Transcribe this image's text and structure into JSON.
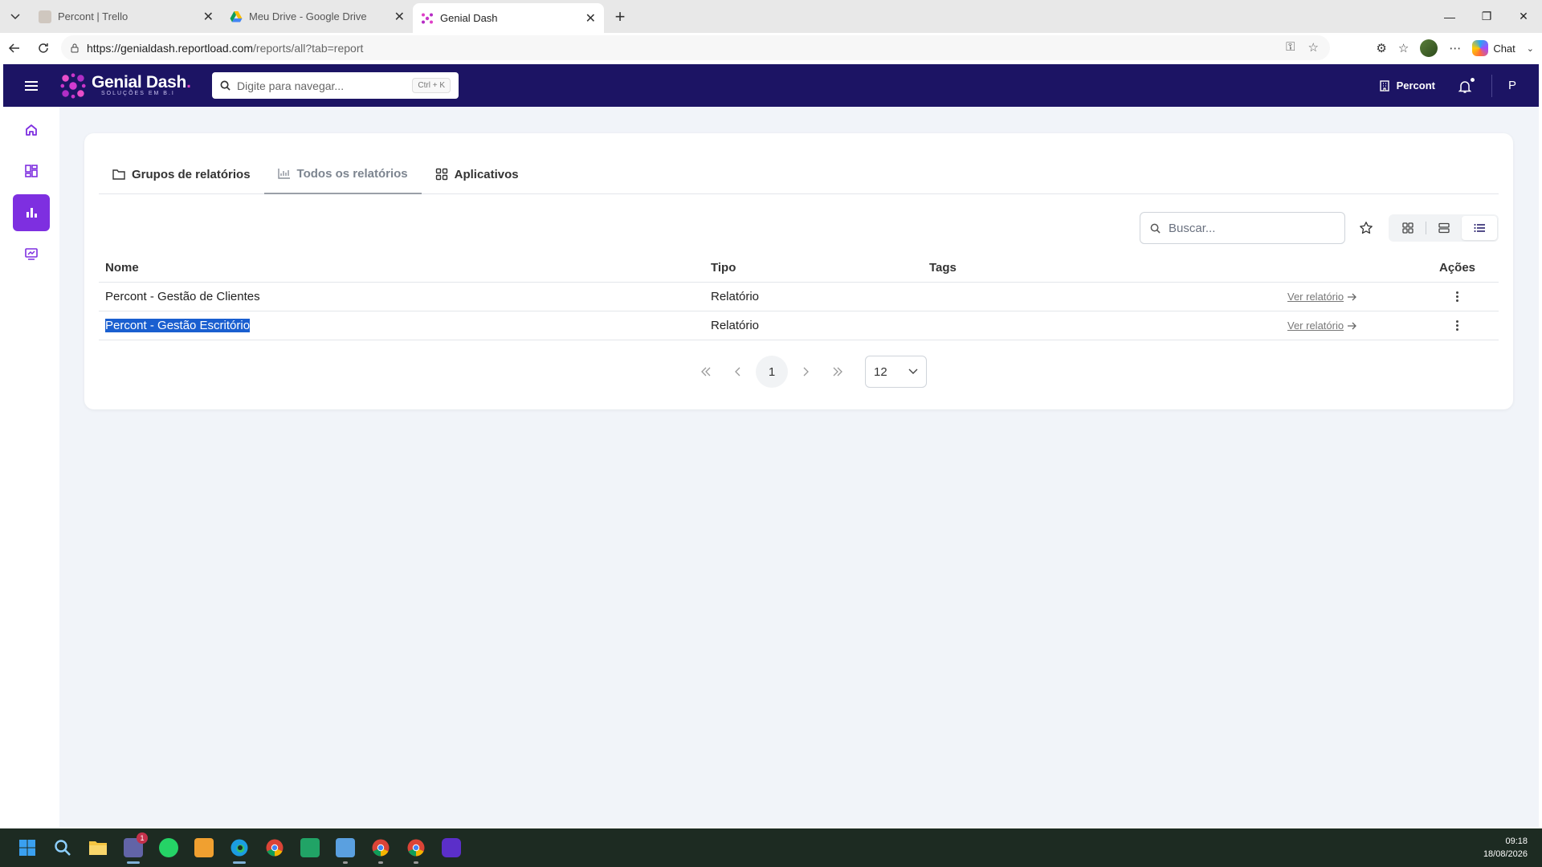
{
  "browser": {
    "tabs": [
      {
        "title": "Percont | Trello",
        "active": false
      },
      {
        "title": "Meu Drive - Google Drive",
        "active": false
      },
      {
        "title": "Genial Dash",
        "active": true
      }
    ],
    "url_host": "https://genialdash.reportload.com",
    "url_path": "/reports/all?tab=report",
    "copilot_label": "Chat"
  },
  "app": {
    "brand_name": "Genial Dash",
    "brand_dot": ".",
    "brand_sub": "SOLUÇÕES EM B.I",
    "nav_search_placeholder": "Digite para navegar...",
    "nav_search_shortcut": "Ctrl + K",
    "org_name": "Percont",
    "user_initial": "P",
    "colors": {
      "navbar": "#1c1464",
      "accent": "#7e2fe0",
      "brand_pink": "#e040c8"
    },
    "sidebar": [
      {
        "icon": "home-icon"
      },
      {
        "icon": "dashboard-icon"
      },
      {
        "icon": "bar-chart-icon",
        "active": true
      },
      {
        "icon": "presentation-icon"
      }
    ],
    "tabs": [
      {
        "label": "Grupos de relatórios",
        "icon": "folder-icon"
      },
      {
        "label": "Todos os relatórios",
        "icon": "chart-icon",
        "active": true
      },
      {
        "label": "Aplicativos",
        "icon": "grid-icon"
      }
    ],
    "search_placeholder": "Buscar...",
    "table": {
      "headers": {
        "name": "Nome",
        "tipo": "Tipo",
        "tags": "Tags",
        "acoes": "Ações"
      },
      "rows": [
        {
          "name": "Percont - Gestão de Clientes",
          "tipo": "Relatório",
          "tags": "",
          "link": "Ver relatório"
        },
        {
          "name": "Percont - Gestão Escritório",
          "tipo": "Relatório",
          "tags": "",
          "link": "Ver relatório",
          "selected": true
        }
      ]
    },
    "pagination": {
      "current_page": "1",
      "page_size": "12"
    }
  },
  "taskbar": {
    "time": "09:18",
    "date": "18/08/2026",
    "teams_badge": "1"
  }
}
